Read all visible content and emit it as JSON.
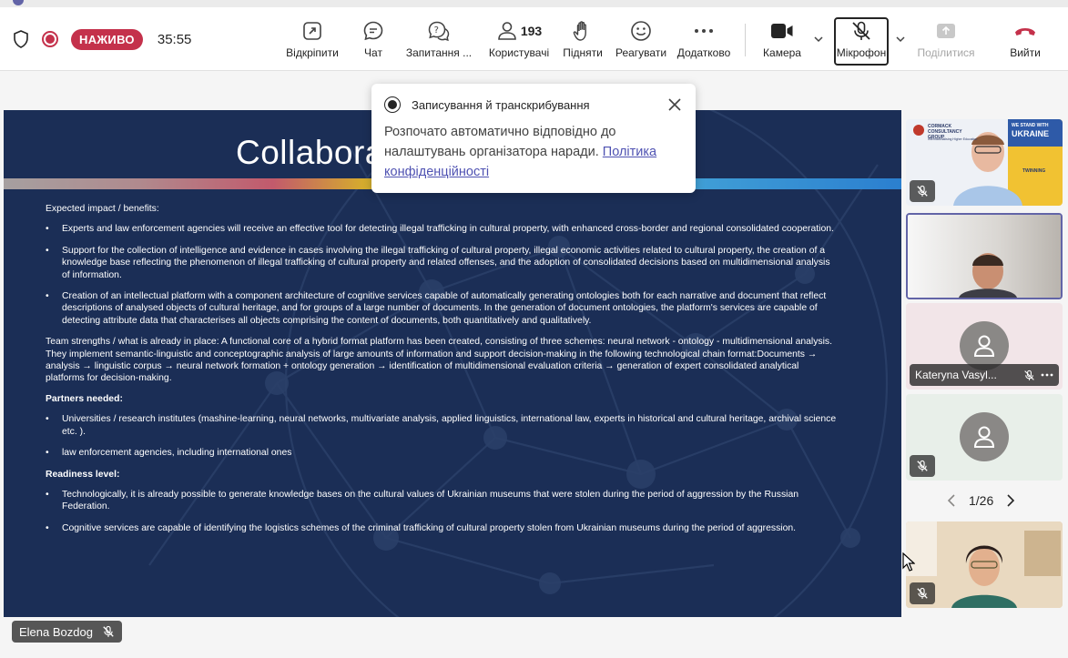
{
  "status": {
    "live_label": "НАЖИВО",
    "timer": "35:55"
  },
  "toolbar": {
    "popout_label": "Відкріпити",
    "chat_label": "Чат",
    "qa_label": "Запитання ...",
    "people_label": "Користувачі",
    "people_count": "193",
    "raise_label": "Підняти",
    "react_label": "Реагувати",
    "more_label": "Додатково",
    "camera_label": "Камера",
    "mic_label": "Мікрофон",
    "share_label": "Поділитися",
    "leave_label": "Вийти"
  },
  "toast": {
    "title": "Записування й транскрибування",
    "body": "Розпочато автоматично відповідно до налаштувань організатора наради.",
    "link": "Політика конфіденційності"
  },
  "slide": {
    "title": "Collabora",
    "impact_heading": "Expected impact / benefits:",
    "impact_items": [
      "Experts and law enforcement agencies will receive an effective tool for detecting illegal trafficking in cultural property, with enhanced cross-border and regional consolidated cooperation.",
      "Support for the collection of intelligence and evidence in cases involving the illegal trafficking of cultural property, illegal economic activities related to cultural property, the creation of a knowledge base reflecting the phenomenon of illegal trafficking of cultural property and related offenses, and the adoption of consolidated decisions based on multidimensional analysis of information.",
      "Creation of an intellectual platform with a component architecture of cognitive services capable of automatically generating ontologies both for each narrative and document that reflect descriptions of analysed objects of cultural heritage, and for groups of a large number of documents. In the generation of document ontologies, the platform's services are capable of detecting attribute data that characterises all objects comprising the content of documents, both quantitatively and qualitatively."
    ],
    "team_paragraph": "Team strengths / what is already in place: A functional core of a hybrid format platform has been created, consisting of three schemes: neural network - ontology - multidimensional analysis. They implement semantic-linguistic and conceptographic analysis of large amounts of information and support decision-making in the following technological chain format:Documents → analysis → linguistic corpus → neural network formation + ontology generation → identification of multidimensional evaluation criteria → generation of expert consolidated analytical platforms for decision-making.",
    "partners_heading": "Partners needed",
    "partners_items": [
      "Universities / research institutes (mashine-learning, neural networks, multivariate analysis, applied linguistics, international law, experts in historical and cultural heritage, archival science etc. ).",
      "law enforcement agencies, including international ones"
    ],
    "readiness_heading": "Readiness level:",
    "readiness_items": [
      "Technologically, it is already possible to generate knowledge bases on the cultural values of Ukrainian museums that were stolen during the period of aggression by the Russian Federation.",
      "Cognitive services are capable of identifying the logistics schemes of the criminal trafficking of cultural property stolen from Ukrainian museums during the period of aggression."
    ]
  },
  "presenter": {
    "name": "Elena Bozdog"
  },
  "participants": {
    "tile1_logo_left": "CORMACK CONSULTANCY GROUP",
    "tile1_logo_left_sub": "Internationalising Higher Education",
    "tile1_banner_top": "WE STAND WITH",
    "tile1_banner_main": "UKRAINE",
    "tile1_logo_right": "TWINNING",
    "tile3_name": "Kateryna Vasyl...",
    "page_indicator": "1/26"
  }
}
